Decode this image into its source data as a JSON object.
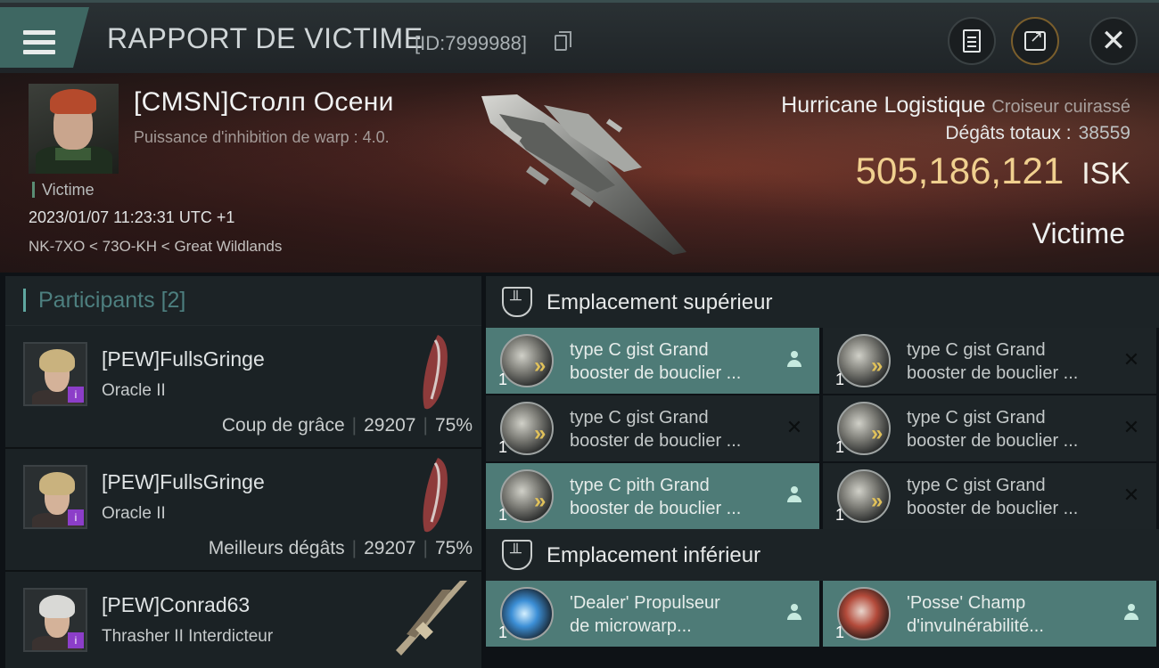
{
  "header": {
    "title": "RAPPORT DE VICTIME",
    "report_id": "[ID:7999988]",
    "icons": [
      "menu-icon",
      "clipboard-icon",
      "share-icon",
      "close-icon"
    ]
  },
  "victim": {
    "name": "[CMSN]Столп Осени",
    "subtitle": "Puissance d'inhibition de warp : 4.0.",
    "role": "Victime",
    "datetime": "2023/01/07 11:23:31 UTC +1",
    "location": "NK-7XO < 73O-KH < Great Wildlands",
    "ship_name": "Hurricane Logistique",
    "ship_class": "Croiseur cuirassé",
    "damage_label": "Dégâts totaux :",
    "damage_value": "38559",
    "isk_value": "505,186,121",
    "isk_unit": "ISK",
    "tag": "Victime"
  },
  "participants": {
    "title": "Participants",
    "count": "[2]",
    "rows": [
      {
        "name": "[PEW]FullsGringe",
        "ship": "Oracle II",
        "stat_label": "Coup de grâce",
        "damage": "29207",
        "percent": "75%"
      },
      {
        "name": "[PEW]FullsGringe",
        "ship": "Oracle II",
        "stat_label": "Meilleurs dégâts",
        "damage": "29207",
        "percent": "75%"
      },
      {
        "name": "[PEW]Conrad63",
        "ship": "Thrasher II Interdicteur",
        "stat_label": "",
        "damage": "",
        "percent": ""
      }
    ]
  },
  "slots": {
    "high_label": "Emplacement supérieur",
    "low_label": "Emplacement inférieur",
    "high": [
      {
        "line1": "type C gist Grand",
        "line2": "booster de bouclier ...",
        "qty": "1",
        "status": "person"
      },
      {
        "line1": "type C gist Grand",
        "line2": "booster de bouclier ...",
        "qty": "1",
        "status": "x"
      },
      {
        "line1": "type C gist Grand",
        "line2": "booster de bouclier ...",
        "qty": "1",
        "status": "x"
      },
      {
        "line1": "type C gist Grand",
        "line2": "booster de bouclier ...",
        "qty": "1",
        "status": "x"
      },
      {
        "line1": "type C pith Grand",
        "line2": "booster de bouclier ...",
        "qty": "1",
        "status": "person"
      },
      {
        "line1": "type C gist Grand",
        "line2": "booster de bouclier ...",
        "qty": "1",
        "status": "x"
      }
    ],
    "low": [
      {
        "line1": "'Dealer' Propulseur",
        "line2": "de microwarp...",
        "qty": "1",
        "status": "person"
      },
      {
        "line1": "'Posse' Champ",
        "line2": "d'invulnérabilité...",
        "qty": "1",
        "status": "person"
      }
    ]
  },
  "colors": {
    "accent": "#4e7b77",
    "isk": "#f0d08f",
    "badge": "#8c3ec9"
  }
}
